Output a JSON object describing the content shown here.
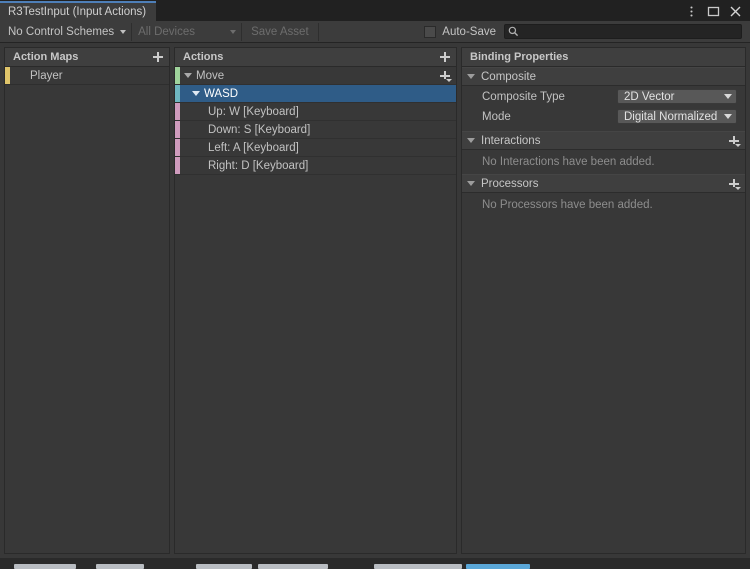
{
  "window": {
    "tab_title": "R3TestInput (Input Actions)",
    "controls": [
      {
        "name": "more-options",
        "glyph": "kebab"
      },
      {
        "name": "maximize",
        "glyph": "square"
      },
      {
        "name": "close",
        "glyph": "x"
      }
    ]
  },
  "toolbar": {
    "control_schemes_label": "No Control Schemes",
    "devices_label": "All Devices",
    "save_asset_label": "Save Asset",
    "autosave_label": "Auto-Save",
    "autosave_checked": false,
    "search_value": "",
    "search_placeholder": ""
  },
  "action_maps": {
    "header": "Action Maps",
    "add_label": "+",
    "items": [
      {
        "label": "Player",
        "accent": "#e0c56a",
        "selected": false
      }
    ]
  },
  "actions": {
    "header": "Actions",
    "add_label": "+",
    "rows": [
      {
        "label": "Move",
        "accent": "#9fd39b",
        "indent": 4,
        "arrow": true,
        "selected": false,
        "add": true
      },
      {
        "label": "WASD",
        "accent": "#6fb6c0",
        "indent": 12,
        "arrow": true,
        "selected": true,
        "add": false
      },
      {
        "label": "Up: W [Keyboard]",
        "accent": "#cf9bbd",
        "indent": 28,
        "arrow": false,
        "selected": false,
        "add": false
      },
      {
        "label": "Down: S [Keyboard]",
        "accent": "#cf9bbd",
        "indent": 28,
        "arrow": false,
        "selected": false,
        "add": false
      },
      {
        "label": "Left: A [Keyboard]",
        "accent": "#cf9bbd",
        "indent": 28,
        "arrow": false,
        "selected": false,
        "add": false
      },
      {
        "label": "Right: D [Keyboard]",
        "accent": "#cf9bbd",
        "indent": 28,
        "arrow": false,
        "selected": false,
        "add": false
      }
    ]
  },
  "binding_properties": {
    "header": "Binding Properties",
    "composite": {
      "title": "Composite",
      "type_label": "Composite Type",
      "type_value": "2D Vector",
      "mode_label": "Mode",
      "mode_value": "Digital Normalized"
    },
    "interactions": {
      "title": "Interactions",
      "empty": "No Interactions have been added."
    },
    "processors": {
      "title": "Processors",
      "empty": "No Processors have been added."
    }
  },
  "colors": {
    "selection": "#2f5c87",
    "tab_accent": "#4e7fb8",
    "panel_bg": "#383838",
    "header_bg": "#3f3f3f"
  }
}
